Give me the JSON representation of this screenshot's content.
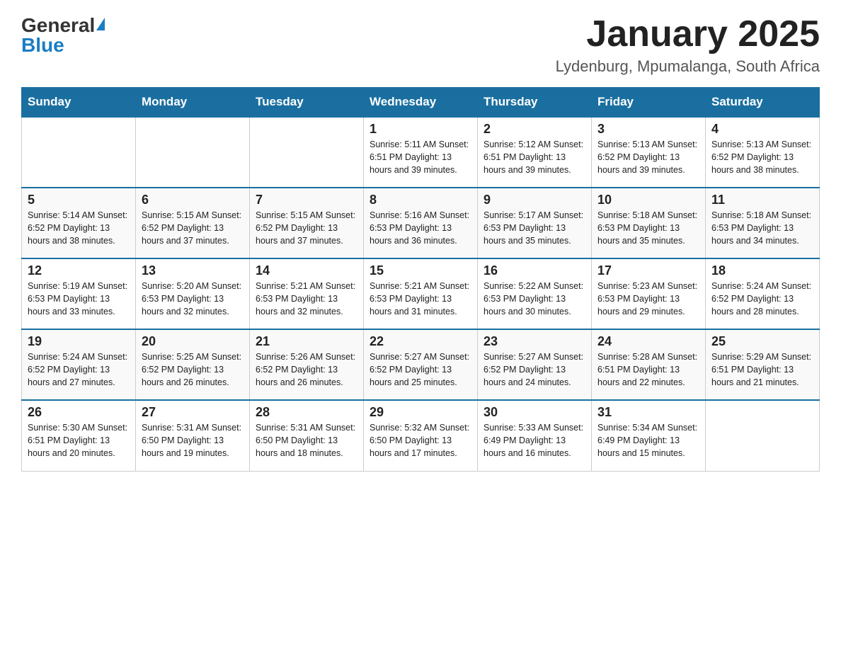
{
  "header": {
    "logo_general": "General",
    "logo_blue": "Blue",
    "month_title": "January 2025",
    "location": "Lydenburg, Mpumalanga, South Africa"
  },
  "days_of_week": [
    "Sunday",
    "Monday",
    "Tuesday",
    "Wednesday",
    "Thursday",
    "Friday",
    "Saturday"
  ],
  "weeks": [
    {
      "days": [
        {
          "date": "",
          "info": ""
        },
        {
          "date": "",
          "info": ""
        },
        {
          "date": "",
          "info": ""
        },
        {
          "date": "1",
          "info": "Sunrise: 5:11 AM\nSunset: 6:51 PM\nDaylight: 13 hours\nand 39 minutes."
        },
        {
          "date": "2",
          "info": "Sunrise: 5:12 AM\nSunset: 6:51 PM\nDaylight: 13 hours\nand 39 minutes."
        },
        {
          "date": "3",
          "info": "Sunrise: 5:13 AM\nSunset: 6:52 PM\nDaylight: 13 hours\nand 39 minutes."
        },
        {
          "date": "4",
          "info": "Sunrise: 5:13 AM\nSunset: 6:52 PM\nDaylight: 13 hours\nand 38 minutes."
        }
      ]
    },
    {
      "days": [
        {
          "date": "5",
          "info": "Sunrise: 5:14 AM\nSunset: 6:52 PM\nDaylight: 13 hours\nand 38 minutes."
        },
        {
          "date": "6",
          "info": "Sunrise: 5:15 AM\nSunset: 6:52 PM\nDaylight: 13 hours\nand 37 minutes."
        },
        {
          "date": "7",
          "info": "Sunrise: 5:15 AM\nSunset: 6:52 PM\nDaylight: 13 hours\nand 37 minutes."
        },
        {
          "date": "8",
          "info": "Sunrise: 5:16 AM\nSunset: 6:53 PM\nDaylight: 13 hours\nand 36 minutes."
        },
        {
          "date": "9",
          "info": "Sunrise: 5:17 AM\nSunset: 6:53 PM\nDaylight: 13 hours\nand 35 minutes."
        },
        {
          "date": "10",
          "info": "Sunrise: 5:18 AM\nSunset: 6:53 PM\nDaylight: 13 hours\nand 35 minutes."
        },
        {
          "date": "11",
          "info": "Sunrise: 5:18 AM\nSunset: 6:53 PM\nDaylight: 13 hours\nand 34 minutes."
        }
      ]
    },
    {
      "days": [
        {
          "date": "12",
          "info": "Sunrise: 5:19 AM\nSunset: 6:53 PM\nDaylight: 13 hours\nand 33 minutes."
        },
        {
          "date": "13",
          "info": "Sunrise: 5:20 AM\nSunset: 6:53 PM\nDaylight: 13 hours\nand 32 minutes."
        },
        {
          "date": "14",
          "info": "Sunrise: 5:21 AM\nSunset: 6:53 PM\nDaylight: 13 hours\nand 32 minutes."
        },
        {
          "date": "15",
          "info": "Sunrise: 5:21 AM\nSunset: 6:53 PM\nDaylight: 13 hours\nand 31 minutes."
        },
        {
          "date": "16",
          "info": "Sunrise: 5:22 AM\nSunset: 6:53 PM\nDaylight: 13 hours\nand 30 minutes."
        },
        {
          "date": "17",
          "info": "Sunrise: 5:23 AM\nSunset: 6:53 PM\nDaylight: 13 hours\nand 29 minutes."
        },
        {
          "date": "18",
          "info": "Sunrise: 5:24 AM\nSunset: 6:52 PM\nDaylight: 13 hours\nand 28 minutes."
        }
      ]
    },
    {
      "days": [
        {
          "date": "19",
          "info": "Sunrise: 5:24 AM\nSunset: 6:52 PM\nDaylight: 13 hours\nand 27 minutes."
        },
        {
          "date": "20",
          "info": "Sunrise: 5:25 AM\nSunset: 6:52 PM\nDaylight: 13 hours\nand 26 minutes."
        },
        {
          "date": "21",
          "info": "Sunrise: 5:26 AM\nSunset: 6:52 PM\nDaylight: 13 hours\nand 26 minutes."
        },
        {
          "date": "22",
          "info": "Sunrise: 5:27 AM\nSunset: 6:52 PM\nDaylight: 13 hours\nand 25 minutes."
        },
        {
          "date": "23",
          "info": "Sunrise: 5:27 AM\nSunset: 6:52 PM\nDaylight: 13 hours\nand 24 minutes."
        },
        {
          "date": "24",
          "info": "Sunrise: 5:28 AM\nSunset: 6:51 PM\nDaylight: 13 hours\nand 22 minutes."
        },
        {
          "date": "25",
          "info": "Sunrise: 5:29 AM\nSunset: 6:51 PM\nDaylight: 13 hours\nand 21 minutes."
        }
      ]
    },
    {
      "days": [
        {
          "date": "26",
          "info": "Sunrise: 5:30 AM\nSunset: 6:51 PM\nDaylight: 13 hours\nand 20 minutes."
        },
        {
          "date": "27",
          "info": "Sunrise: 5:31 AM\nSunset: 6:50 PM\nDaylight: 13 hours\nand 19 minutes."
        },
        {
          "date": "28",
          "info": "Sunrise: 5:31 AM\nSunset: 6:50 PM\nDaylight: 13 hours\nand 18 minutes."
        },
        {
          "date": "29",
          "info": "Sunrise: 5:32 AM\nSunset: 6:50 PM\nDaylight: 13 hours\nand 17 minutes."
        },
        {
          "date": "30",
          "info": "Sunrise: 5:33 AM\nSunset: 6:49 PM\nDaylight: 13 hours\nand 16 minutes."
        },
        {
          "date": "31",
          "info": "Sunrise: 5:34 AM\nSunset: 6:49 PM\nDaylight: 13 hours\nand 15 minutes."
        },
        {
          "date": "",
          "info": ""
        }
      ]
    }
  ]
}
